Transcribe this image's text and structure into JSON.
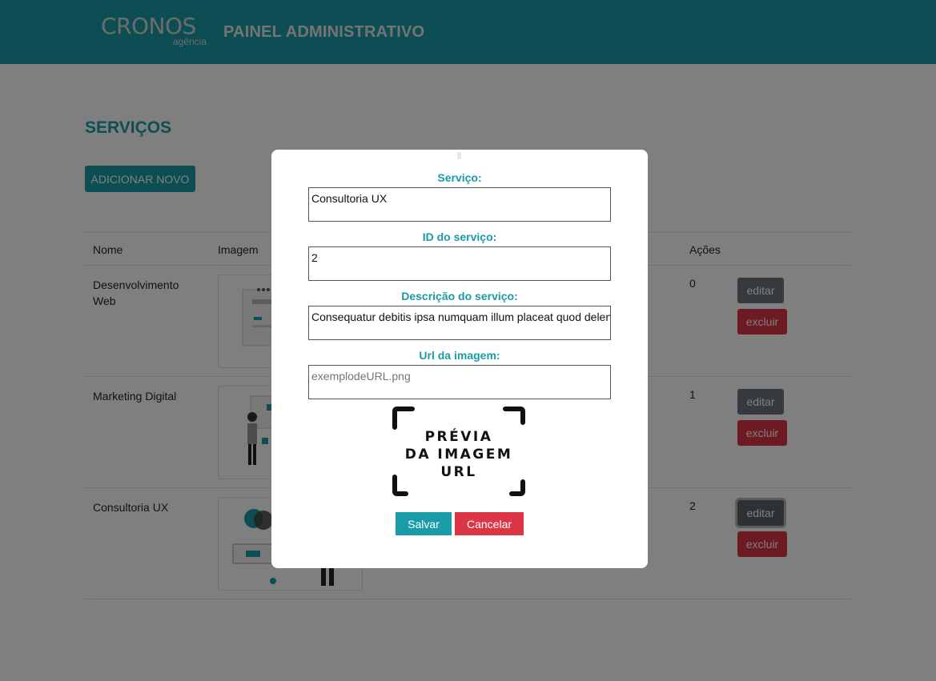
{
  "header": {
    "brand_name": "CRONOS",
    "brand_sub": "agência",
    "title": "PAINEL ADMINISTRATIVO"
  },
  "page": {
    "title": "SERVIÇOS",
    "add_button": "ADICIONAR NOVO"
  },
  "table": {
    "columns": {
      "name": "Nome",
      "image": "Imagem",
      "actions": "Ações"
    },
    "rows": [
      {
        "name": "Desenvolvimento Web",
        "id": "0"
      },
      {
        "name": "Marketing Digital",
        "id": "1"
      },
      {
        "name": "Consultoria UX",
        "id": "2"
      }
    ],
    "edit_label": "editar",
    "delete_label": "excluir"
  },
  "modal": {
    "service_label": "Serviço:",
    "service_value": "Consultoria UX",
    "id_label": "ID do serviço:",
    "id_value": "2",
    "description_label": "Descrição do serviço:",
    "description_value": "Consequatur debitis ipsa numquam illum placeat quod deleniti",
    "url_label": "Url da imagem:",
    "url_placeholder": "exemplodeURL.png",
    "preview_line1": "PRÉVIA",
    "preview_line2": "DA IMAGEM",
    "preview_line3": "URL",
    "save_label": "Salvar",
    "cancel_label": "Cancelar"
  },
  "colors": {
    "primary": "#1a9ba8",
    "danger": "#dc3545",
    "secondary": "#6c757d"
  }
}
